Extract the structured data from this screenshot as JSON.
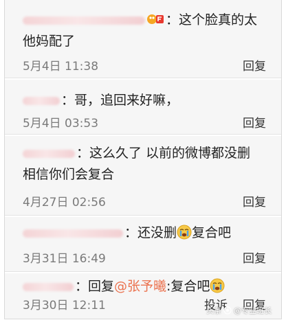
{
  "colors": {
    "username": "#eb7350",
    "meta": "#7a7a7a",
    "panel": "#f6f6f6"
  },
  "comments": [
    {
      "text": "：这个脸真的太他妈配了",
      "time": "5月4日 11:38",
      "actions": [
        "回复"
      ]
    },
    {
      "text": "：哥，追回来好嘛，",
      "time": "5月4日 03:53",
      "actions": [
        "回复"
      ]
    },
    {
      "text": "：这么久了 以前的微博都没删  相信你们会复合",
      "time": "4月27日 02:56",
      "actions": [
        "回复"
      ]
    },
    {
      "text_before": "：还没删",
      "emoji": "crying-face",
      "text_after": "复合吧",
      "time": "3月31日 16:49",
      "actions": [
        "回复"
      ]
    },
    {
      "text_before": "：回复",
      "mention": "@张予曦",
      "text_mid": ":复合吧",
      "emoji": "crying-face",
      "time": "3月30日 12:11",
      "actions": [
        "投诉",
        "回复"
      ]
    }
  ],
  "watermark": {
    "text_a": "头条",
    "text_b": "@专业班长"
  }
}
